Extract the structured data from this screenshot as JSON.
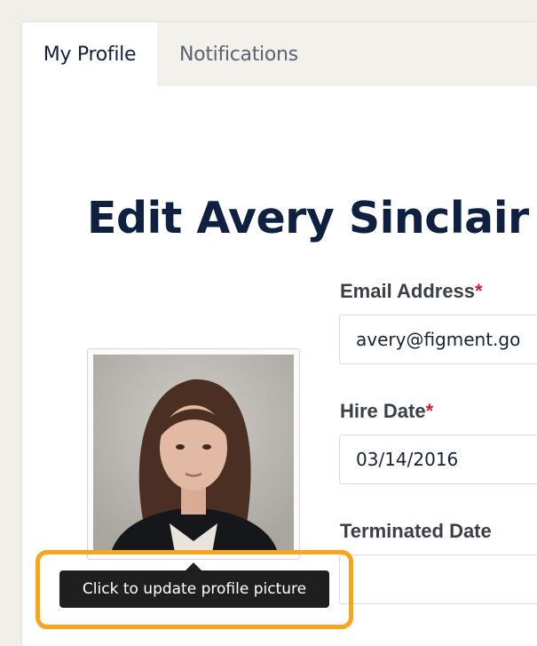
{
  "tabs": [
    {
      "label": "My Profile",
      "active": true
    },
    {
      "label": "Notifications",
      "active": false
    }
  ],
  "page": {
    "title": "Edit Avery Sinclair"
  },
  "form": {
    "email": {
      "label": "Email Address",
      "required_marker": "*",
      "value": "avery@figment.go"
    },
    "hire_date": {
      "label": "Hire Date",
      "required_marker": "*",
      "value": "03/14/2016"
    },
    "terminated_date": {
      "label": "Terminated Date",
      "value": ""
    }
  },
  "profile_picture": {
    "tooltip": "Click to update profile picture"
  },
  "colors": {
    "background": "#f1efea",
    "title": "#0f2040",
    "required": "#cc2233",
    "tooltip_bg": "#1f1f1f",
    "highlight": "#f7a51a"
  }
}
